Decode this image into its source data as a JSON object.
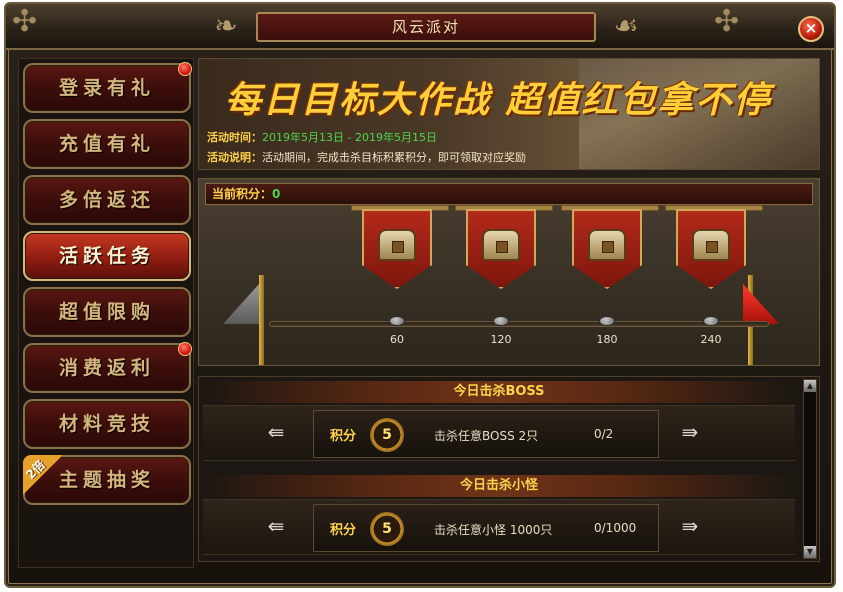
{
  "window": {
    "title": "风云派对",
    "close_label": "×"
  },
  "sidebar": {
    "items": [
      {
        "label": "登录有礼",
        "dot": true
      },
      {
        "label": "充值有礼",
        "dot": false
      },
      {
        "label": "多倍返还",
        "dot": false
      },
      {
        "label": "活跃任务",
        "dot": false,
        "active": true
      },
      {
        "label": "超值限购",
        "dot": false
      },
      {
        "label": "消费返利",
        "dot": true
      },
      {
        "label": "材料竞技",
        "dot": false
      },
      {
        "label": "主题抽奖",
        "dot": false,
        "badge": "2倍"
      }
    ]
  },
  "banner": {
    "headline": "每日目标大作战  超值红包拿不停",
    "time_label": "活动时间：",
    "time_value": "2019年5月13日 - 2019年5月15日",
    "desc_label": "活动说明：",
    "desc_value": "活动期间，完成击杀目标积累积分，即可领取对应奖励"
  },
  "progress": {
    "points_label": "当前积分：",
    "points_value": "0",
    "milestones": [
      "60",
      "120",
      "180",
      "240"
    ],
    "reward_icon": "treasure-chest-icon"
  },
  "tasks": [
    {
      "header": "今日击杀BOSS",
      "score_label": "积分",
      "score": "5",
      "desc": "击杀任意BOSS 2只",
      "progress": "0/2"
    },
    {
      "header": "今日击杀小怪",
      "score_label": "积分",
      "score": "5",
      "desc": "击杀任意小怪 1000只",
      "progress": "0/1000"
    }
  ],
  "icons": {
    "prev": "arrow-left-icon",
    "next": "arrow-right-icon",
    "close": "close-icon"
  },
  "colors": {
    "accent_gold": "#ffd24a",
    "accent_red": "#b22a1a",
    "text_green": "#4cd64c"
  }
}
